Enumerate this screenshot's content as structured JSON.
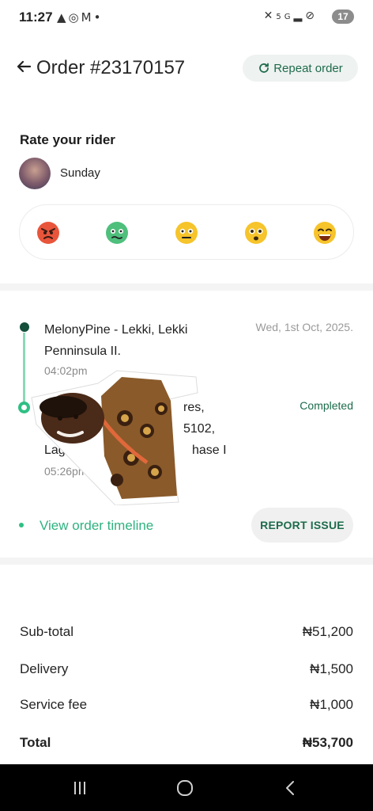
{
  "status_bar": {
    "time": "11:27",
    "left_icons": [
      "warning-icon",
      "whatsapp-icon",
      "gmail-icon",
      "dot-icon"
    ],
    "right_icons": [
      "mute-icon",
      "5g-icon",
      "signal-icon",
      "dnd-icon"
    ],
    "battery": "17"
  },
  "header": {
    "title": "Order #23170157",
    "repeat_label": "Repeat order"
  },
  "rating": {
    "title": "Rate your rider",
    "rider_name": "Sunday",
    "emojis": [
      "angry-face",
      "sick-face",
      "neutral-face",
      "worried-face",
      "laughing-face"
    ]
  },
  "order": {
    "pickup_address": "MelonyPine - Lekki, Lekki Penninsula II.",
    "pickup_time": "04:02pm",
    "date": "Wed, 1st Oct, 2025.",
    "dropoff_lines": [
      "",
      "",
      "Lagos, I"
    ],
    "dropoff_visible_fragments": [
      "res,",
      "5102,",
      "hase I"
    ],
    "dropoff_time": "05:26pm",
    "status": "Completed",
    "timeline_link": "View order timeline",
    "report_label": "REPORT ISSUE"
  },
  "summary": {
    "rows": [
      {
        "label": "Sub-total",
        "value": "₦51,200"
      },
      {
        "label": "Delivery",
        "value": "₦1,500"
      },
      {
        "label": "Service fee",
        "value": "₦1,000"
      },
      {
        "label": "Total",
        "value": "₦53,700"
      }
    ]
  },
  "colors": {
    "accent": "#2fb280",
    "dark_green": "#14503b",
    "repeat_bg": "#eef2f0"
  }
}
